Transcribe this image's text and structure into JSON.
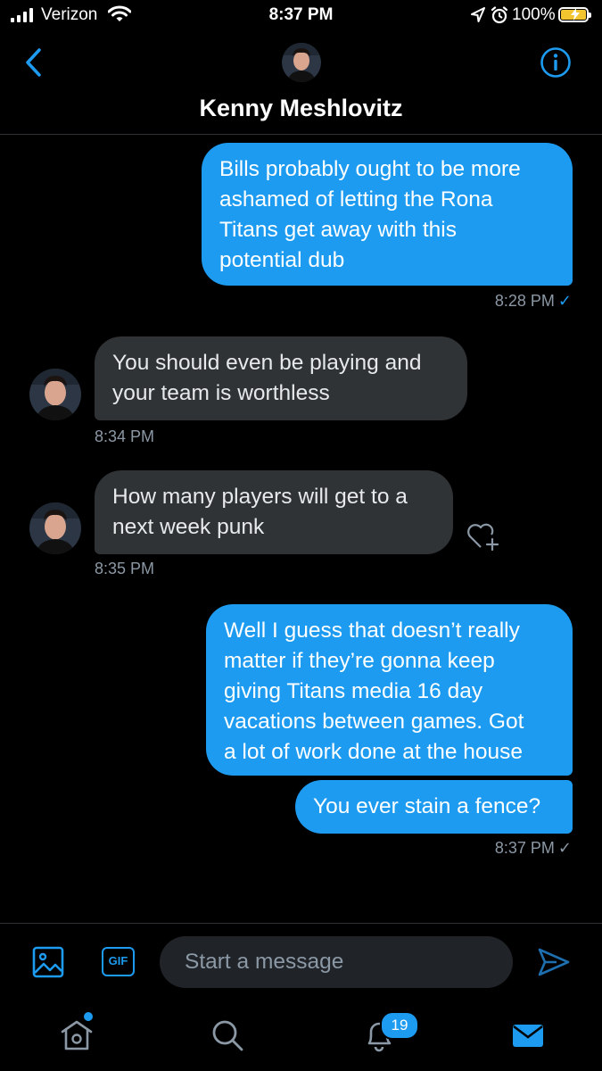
{
  "status_bar": {
    "carrier": "Verizon",
    "time": "8:37 PM",
    "battery_percent": "100%"
  },
  "header": {
    "contact_name": "Kenny Meshlovitz"
  },
  "messages": [
    {
      "direction": "outgoing",
      "text": "Bills probably ought to be more\nashamed of letting the Rona\nTitans get away with this\npotential dub",
      "time": "8:28 PM",
      "read": true
    },
    {
      "direction": "incoming",
      "text": "You should even be playing and\nyour team is worthless",
      "time": "8:34 PM"
    },
    {
      "direction": "incoming",
      "text": "How many players will get to a\nnext week punk",
      "time": "8:35 PM"
    },
    {
      "direction": "outgoing",
      "text": "Well I guess that doesn’t really\nmatter if they’re gonna keep\ngiving Titans media 16 day\nvacations between games. Got\na lot of work done at the house"
    },
    {
      "direction": "outgoing",
      "text": "You ever stain a fence?",
      "time": "8:37 PM",
      "read": false
    }
  ],
  "composer": {
    "gif_label": "GIF",
    "placeholder": "Start a message"
  },
  "tab_bar": {
    "notifications_badge": "19",
    "items": [
      "home-icon",
      "search-icon",
      "bell-icon",
      "mail-icon"
    ]
  },
  "colors": {
    "accent": "#1d9bf0",
    "incoming_bubble": "#2f3336",
    "background": "#000000",
    "muted_text": "#8b98a5"
  }
}
